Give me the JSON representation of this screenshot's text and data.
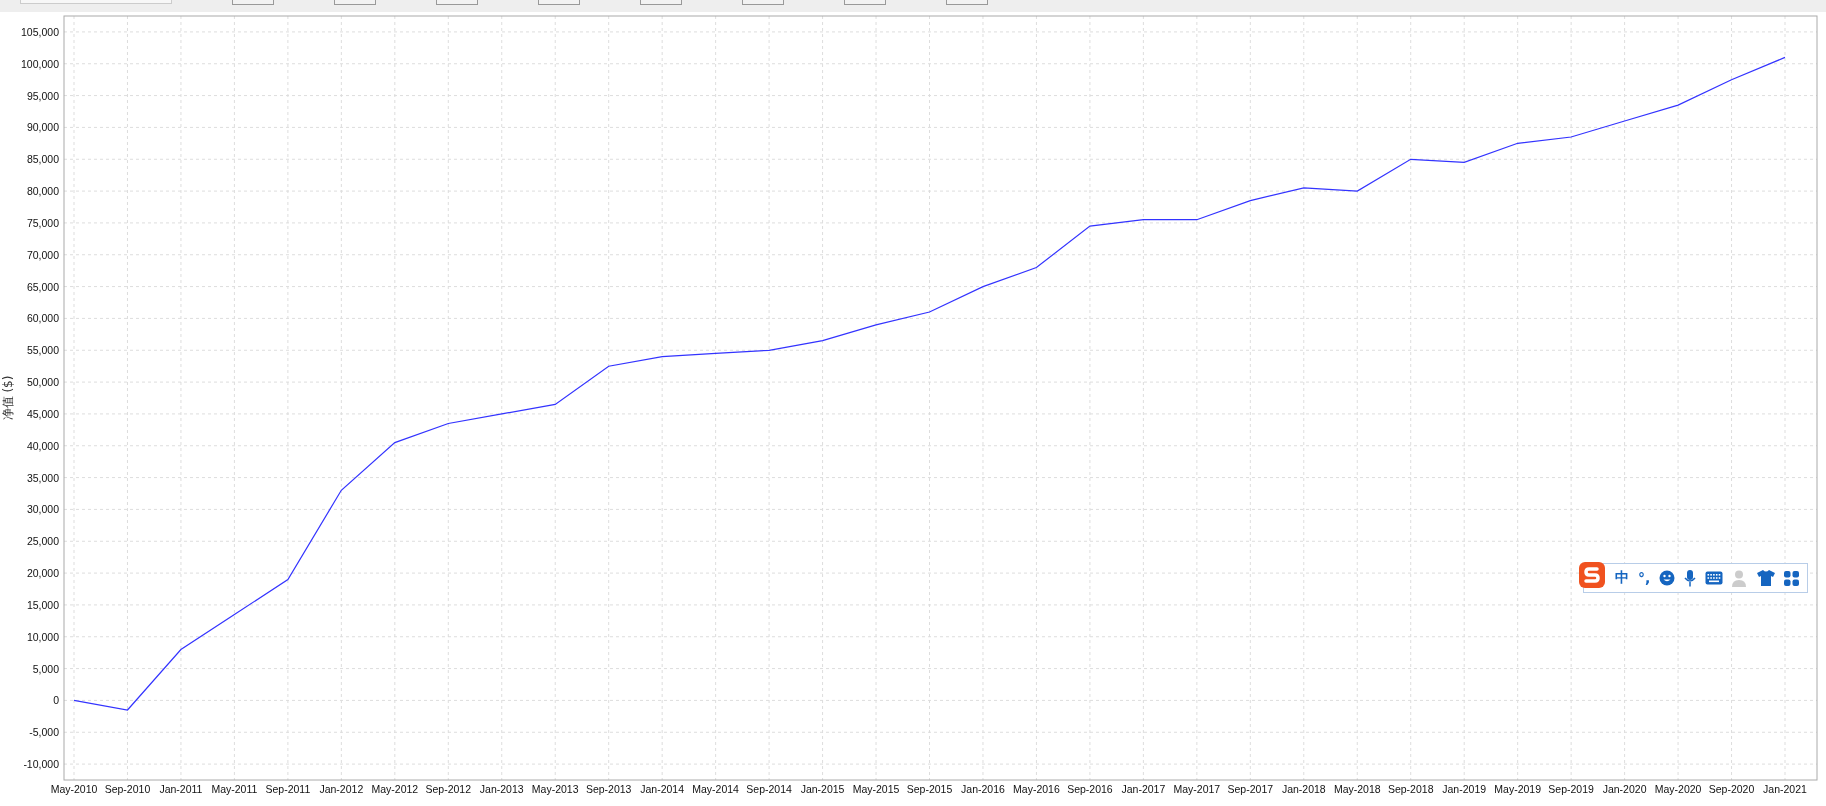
{
  "chart": {
    "chart_data": {
      "type": "line",
      "ylabel": "净值 ($)",
      "grid": true,
      "categories": [
        "May-2010",
        "Sep-2010",
        "Jan-2011",
        "May-2011",
        "Sep-2011",
        "Jan-2012",
        "May-2012",
        "Sep-2012",
        "Jan-2013",
        "May-2013",
        "Sep-2013",
        "Jan-2014",
        "May-2014",
        "Sep-2014",
        "Jan-2015",
        "May-2015",
        "Sep-2015",
        "Jan-2016",
        "May-2016",
        "Sep-2016",
        "Jan-2017",
        "May-2017",
        "Sep-2017",
        "Jan-2018",
        "May-2018",
        "Sep-2018",
        "Jan-2019",
        "May-2019",
        "Sep-2019",
        "Jan-2020",
        "May-2020",
        "Sep-2020",
        "Jan-2021"
      ],
      "series": [
        {
          "color": "#3333ff",
          "values": [
            0,
            -1500,
            8000,
            13500,
            19000,
            33000,
            40500,
            43500,
            45000,
            46500,
            52500,
            54000,
            54500,
            55000,
            56500,
            59000,
            61000,
            65000,
            68000,
            74500,
            75500,
            75500,
            78500,
            80500,
            80000,
            85000,
            84500,
            87500,
            88500,
            91000,
            93500,
            97500,
            101000
          ]
        }
      ],
      "ylim": [
        -12500,
        107500
      ],
      "yticks": [
        {
          "value": -10000,
          "label": "-10,000"
        },
        {
          "value": -5000,
          "label": "-5,000"
        },
        {
          "value": 0,
          "label": "0"
        },
        {
          "value": 5000,
          "label": "5,000"
        },
        {
          "value": 10000,
          "label": "10,000"
        },
        {
          "value": 15000,
          "label": "15,000"
        },
        {
          "value": 20000,
          "label": "20,000"
        },
        {
          "value": 25000,
          "label": "25,000"
        },
        {
          "value": 30000,
          "label": "30,000"
        },
        {
          "value": 35000,
          "label": "35,000"
        },
        {
          "value": 40000,
          "label": "40,000"
        },
        {
          "value": 45000,
          "label": "45,000"
        },
        {
          "value": 50000,
          "label": "50,000"
        },
        {
          "value": 55000,
          "label": "55,000"
        },
        {
          "value": 60000,
          "label": "60,000"
        },
        {
          "value": 65000,
          "label": "65,000"
        },
        {
          "value": 70000,
          "label": "70,000"
        },
        {
          "value": 75000,
          "label": "75,000"
        },
        {
          "value": 80000,
          "label": "80,000"
        },
        {
          "value": 85000,
          "label": "85,000"
        },
        {
          "value": 90000,
          "label": "90,000"
        },
        {
          "value": 95000,
          "label": "95,000"
        },
        {
          "value": 100000,
          "label": "100,000"
        },
        {
          "value": 105000,
          "label": "105,000"
        }
      ]
    }
  },
  "ime": {
    "mode_label": "中",
    "punct_label": "°,",
    "profile_disabled": true
  }
}
